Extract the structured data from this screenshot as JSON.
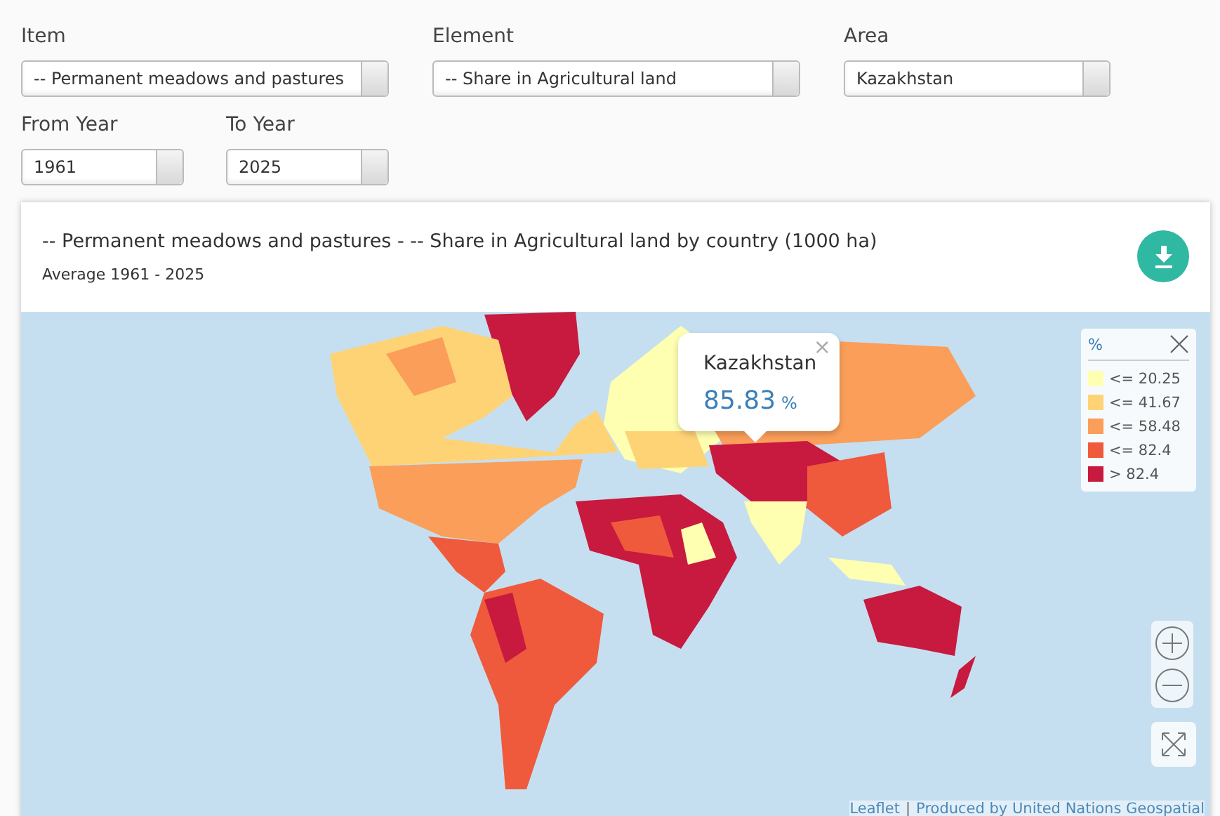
{
  "filters": [
    {
      "label": "Item",
      "value": "-- Permanent meadows and pastures"
    },
    {
      "label": "Element",
      "value": "-- Share in Agricultural land"
    },
    {
      "label": "Area",
      "value": "Kazakhstan"
    },
    {
      "label": "From Year",
      "value": "1961"
    },
    {
      "label": "To Year",
      "value": "2025"
    }
  ],
  "card": {
    "title": "-- Permanent meadows and pastures - -- Share in Agricultural land by country (1000 ha)",
    "subtitle": "Average 1961 - 2025"
  },
  "tooltip": {
    "country": "Kazakhstan",
    "value": "85.83",
    "unit": "%",
    "close": "×"
  },
  "legend": {
    "title": "%",
    "items": [
      {
        "label": "<= 20.25",
        "color": "#ffffb2"
      },
      {
        "label": "<= 41.67",
        "color": "#fed376"
      },
      {
        "label": "<= 58.48",
        "color": "#fa9e5a"
      },
      {
        "label": "<= 82.4",
        "color": "#ef5a3c"
      },
      {
        "label": "> 82.4",
        "color": "#c8193f"
      }
    ]
  },
  "attribution": {
    "link_1": "Leaflet",
    "separator": "|",
    "link_2": "Produced by United Nations Geospatial"
  }
}
